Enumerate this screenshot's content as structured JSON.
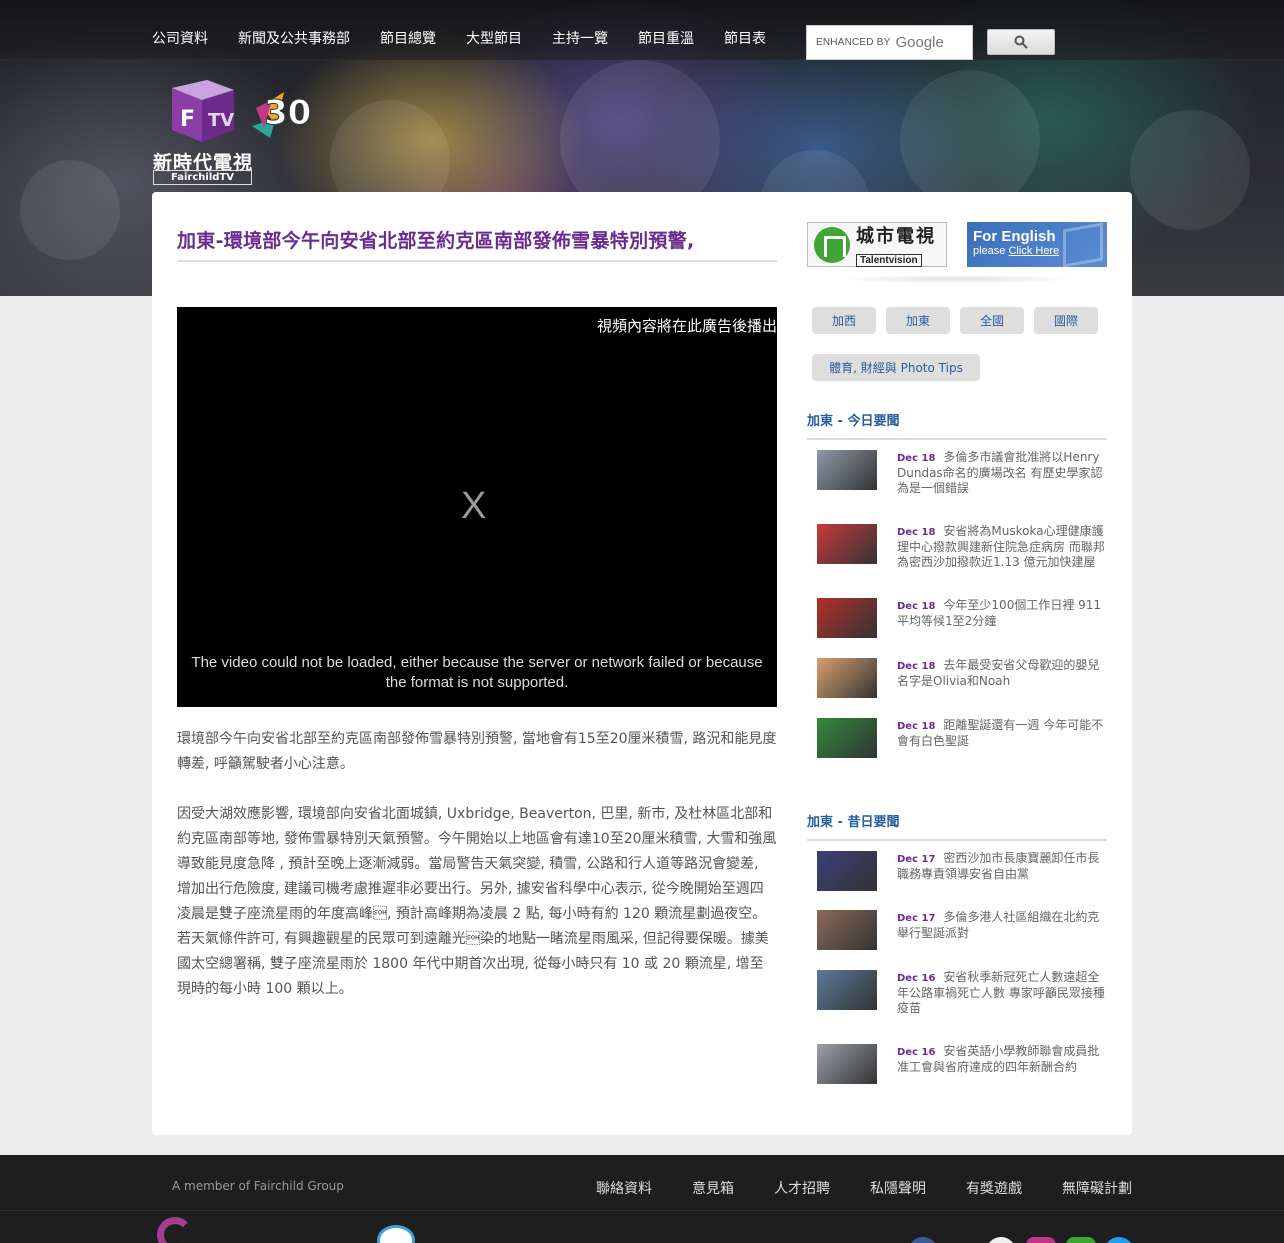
{
  "nav": {
    "items": [
      "公司資料",
      "新聞及公共事務部",
      "節目總覽",
      "大型節目",
      "主持一覽",
      "節目重溫",
      "節目表"
    ]
  },
  "search": {
    "enhanced_by": "ENHANCED BY",
    "google": "Google"
  },
  "logo": {
    "name_cn": "新時代電視",
    "name_en": "FairchildTV"
  },
  "article": {
    "title": "加東-環境部今午向安省北部至約克區南部發佈雪暴特別預警,",
    "video": {
      "ad_text": "視頻內容將在此廣告後播出",
      "close_label": "X",
      "error_text": "The video could not be loaded, either because the server or network failed or because the format is not supported."
    },
    "paragraphs": [
      "環境部今午向安省北部至約克區南部發佈雪暴特別預警, 當地會有15至20厘米積雪, 路況和能見度轉差, 呼籲駕駛者小心注意。",
      "因受大湖效應影響, 環境部向安省北面城鎮, Uxbridge, Beaverton, 巴里, 新市, 及杜林區北部和約克區南部等地, 發佈雪暴特別天氣預警。今午開始以上地區會有達10至20厘米積雪, 大雪和強風導致能見度急降 , 預計至晚上逐漸減弱。當局警告天氣突變, 積雪, 公路和行人道等路況會變差, 增加出行危險度, 建議司機考慮推遲非必要出行。另外, 據安省科學中心表示, 從今晚開始至週四凌晨是雙子座流星雨的年度高峰\u0001, 預計高峰期為凌晨 2 點, 每小時有約 120 顆流星劃過夜空。若天氣條件許可, 有興趣觀星的民眾可到遠離光\u0001染的地點一睹流星雨風采, 但記得要保暖。據美國太空總署稱, 雙子座流星雨於 1800 年代中期首次出現, 從每小時只有 10 或 20 顆流星, 增至現時的每小時 100 顆以上。"
    ]
  },
  "sidebar": {
    "banner_tvb": {
      "cn": "城市電視",
      "en": "Talentvision"
    },
    "banner_english": {
      "line1": "For English",
      "line2_prefix": "please ",
      "line2_link": "Click Here"
    },
    "categories": [
      "加西",
      "加東",
      "全國",
      "國際",
      "體育, 財經與 Photo Tips"
    ],
    "today_title": "加東 - 今日要聞",
    "today_news": [
      {
        "date": "Dec 18",
        "text": "多倫多市議會批准將以Henry Dundas命名的廣場改名 有歷史學家認為是一個錯誤",
        "thumb_color": "#8c9aa8"
      },
      {
        "date": "Dec 18",
        "text": "安省將為Muskoka心理健康護理中心撥款興建新住院急症病房 而聯邦為密西沙加撥款近1.13 億元加快建屋",
        "thumb_color": "#c8393c"
      },
      {
        "date": "Dec 18",
        "text": "今年至少100個工作日裡 911平均等候1至2分鐘",
        "thumb_color": "#b0302a"
      },
      {
        "date": "Dec 18",
        "text": "去年最受安省父母歡迎的嬰兒名字是Olivia和Noah",
        "thumb_color": "#d8a070"
      },
      {
        "date": "Dec 18",
        "text": "距離聖誕還有一週 今年可能不會有白色聖誕",
        "thumb_color": "#2f8a3a"
      }
    ],
    "past_title": "加東 - 昔日要聞",
    "past_news": [
      {
        "date": "Dec 17",
        "text": "密西沙加市長康寶麗卸任市長職務專責領導安省自由黨",
        "thumb_color": "#3b3f7a"
      },
      {
        "date": "Dec 17",
        "text": "多倫多港人社區組織在北約克舉行聖誕派對",
        "thumb_color": "#8a6a5a"
      },
      {
        "date": "Dec 16",
        "text": "安省秋季新冠死亡人數遠超全年公路車禍死亡人數 專家呼籲民眾接種疫苗",
        "thumb_color": "#5a7a9a"
      },
      {
        "date": "Dec 16",
        "text": "安省英語小學教師聯會成員批准工會與省府達成的四年新酬合約",
        "thumb_color": "#9aa0a8"
      }
    ]
  },
  "footer": {
    "member": "A member of Fairchild Group",
    "links": [
      "聯絡資料",
      "意見箱",
      "人才招聘",
      "私隱聲明",
      "有獎遊戲",
      "無障礙計劃"
    ]
  },
  "colors": {
    "title_purple": "#6a2c91",
    "link_blue": "#2a5d9c",
    "footer_bg": "#1e1e1e"
  }
}
